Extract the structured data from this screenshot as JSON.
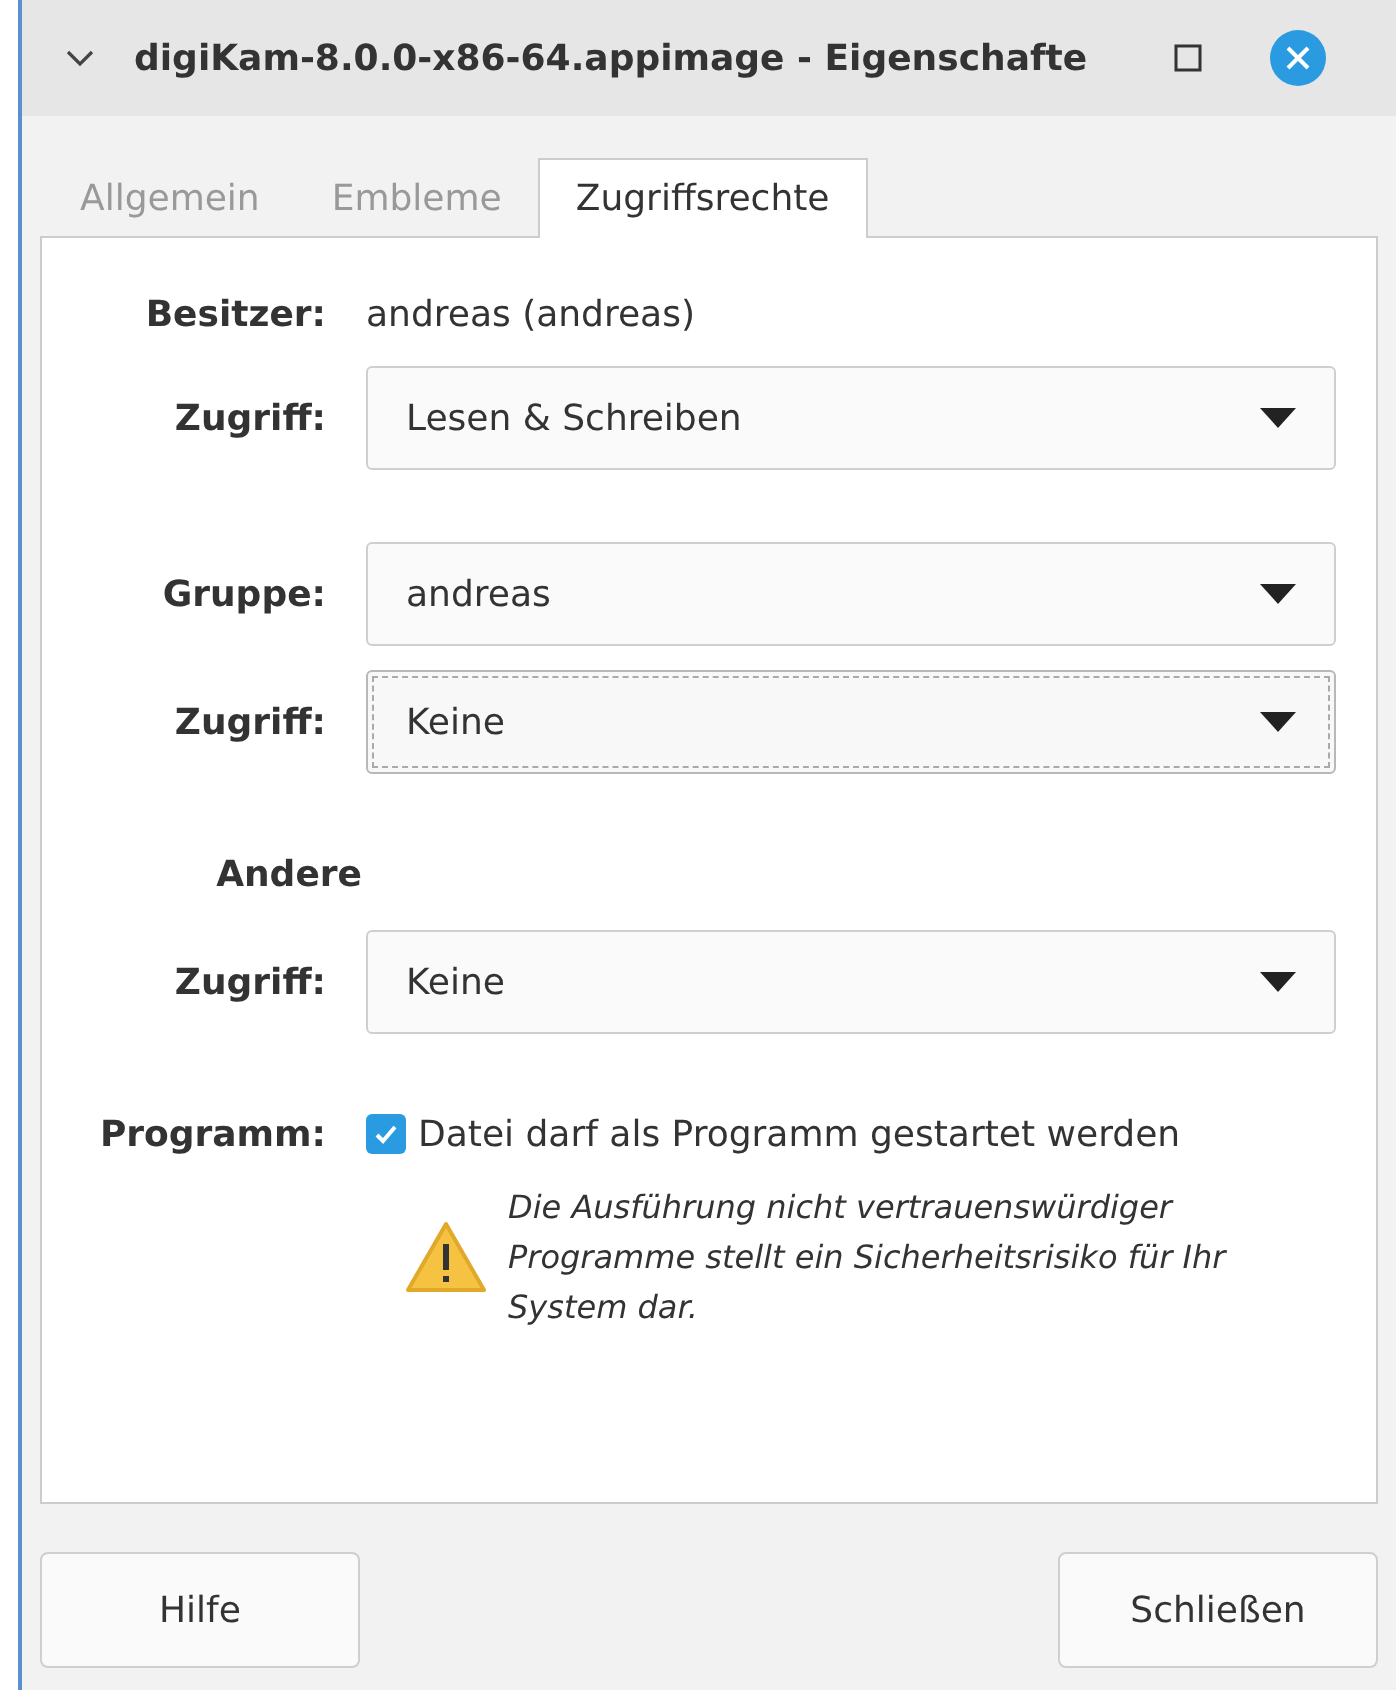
{
  "window": {
    "title": "digiKam-8.0.0-x86-64.appimage - Eigenschafte"
  },
  "tabs": [
    {
      "label": "Allgemein",
      "selected": false
    },
    {
      "label": "Embleme",
      "selected": false
    },
    {
      "label": "Zugriffsrechte",
      "selected": true
    }
  ],
  "rows": [
    {
      "kind": "text",
      "label": "Besitzer:",
      "value": "andreas (andreas)"
    },
    {
      "kind": "dropdown",
      "label": "Zugriff:",
      "value": "Lesen & Schreiben",
      "focused": false
    },
    {
      "kind": "spacer"
    },
    {
      "kind": "dropdown",
      "label": "Gruppe:",
      "value": "andreas",
      "focused": false
    },
    {
      "kind": "dropdown",
      "label": "Zugriff:",
      "value": "Keine",
      "focused": true
    },
    {
      "kind": "spacer"
    },
    {
      "kind": "heading",
      "label": "Andere"
    },
    {
      "kind": "dropdown",
      "label": "Zugriff:",
      "value": "Keine",
      "focused": false
    },
    {
      "kind": "spacer"
    },
    {
      "kind": "checkbox",
      "label": "Programm:",
      "value": "Datei darf als Programm gestartet werden",
      "checked": true,
      "warning": "Die Ausführung nicht vertrauenswürdiger Programme stellt ein Sicherheitsrisiko für Ihr System dar."
    }
  ],
  "buttons": [
    "Hilfe",
    "Schließen"
  ]
}
